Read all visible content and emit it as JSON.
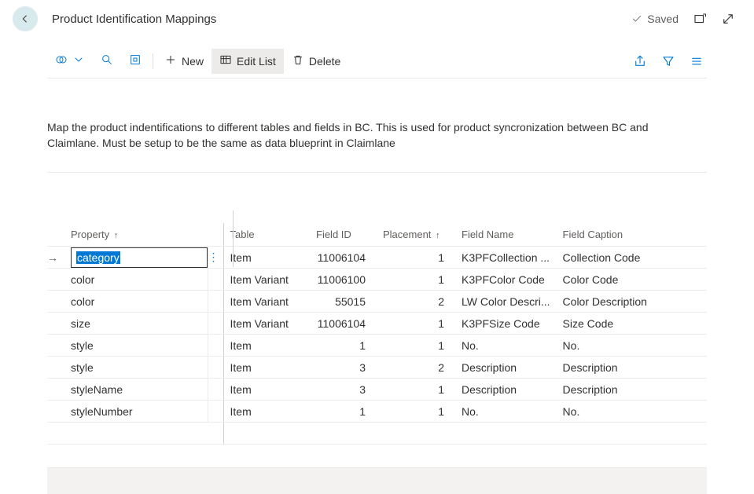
{
  "header": {
    "title": "Product Identification Mappings",
    "saved_label": "Saved"
  },
  "toolbar": {
    "new_label": "New",
    "edit_list_label": "Edit List",
    "delete_label": "Delete"
  },
  "description": "Map the product indentifications to different tables and fields in BC. This is used for product syncronization between BC and Claimlane. Must be setup to be the same as data blueprint in Claimlane",
  "table": {
    "columns": {
      "property": "Property",
      "table": "Table",
      "field_id": "Field ID",
      "placement": "Placement",
      "field_name": "Field Name",
      "field_caption": "Field Caption"
    },
    "sort_glyph": "↑",
    "rows": [
      {
        "property": "category",
        "table": "Item",
        "field_id": "11006104",
        "placement": "1",
        "field_name": "K3PFCollection ...",
        "field_caption": "Collection Code",
        "editing": true
      },
      {
        "property": "color",
        "table": "Item Variant",
        "field_id": "11006100",
        "placement": "1",
        "field_name": "K3PFColor Code",
        "field_caption": "Color Code"
      },
      {
        "property": "color",
        "table": "Item Variant",
        "field_id": "55015",
        "placement": "2",
        "field_name": "LW Color Descri...",
        "field_caption": "Color Description"
      },
      {
        "property": "size",
        "table": "Item Variant",
        "field_id": "11006104",
        "placement": "1",
        "field_name": "K3PFSize Code",
        "field_caption": "Size Code"
      },
      {
        "property": "style",
        "table": "Item",
        "field_id": "1",
        "placement": "1",
        "field_name": "No.",
        "field_caption": "No."
      },
      {
        "property": "style",
        "table": "Item",
        "field_id": "3",
        "placement": "2",
        "field_name": "Description",
        "field_caption": "Description"
      },
      {
        "property": "styleName",
        "table": "Item",
        "field_id": "3",
        "placement": "1",
        "field_name": "Description",
        "field_caption": "Description"
      },
      {
        "property": "styleNumber",
        "table": "Item",
        "field_id": "1",
        "placement": "1",
        "field_name": "No.",
        "field_caption": "No."
      }
    ]
  }
}
